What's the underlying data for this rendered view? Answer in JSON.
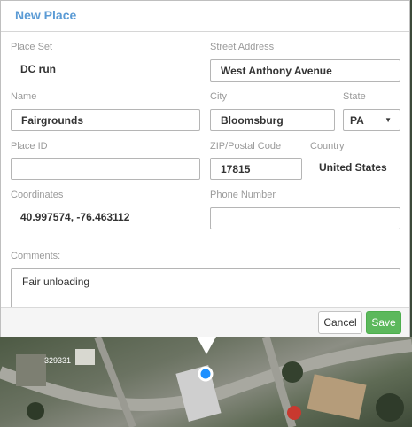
{
  "dialog": {
    "title": "New Place",
    "place_set": {
      "label": "Place Set",
      "value": "DC run"
    },
    "name": {
      "label": "Name",
      "value": "Fairgrounds"
    },
    "place_id": {
      "label": "Place ID",
      "value": ""
    },
    "coordinates": {
      "label": "Coordinates",
      "value": "40.997574, -76.463112"
    },
    "street": {
      "label": "Street Address",
      "value": "West Anthony Avenue"
    },
    "city": {
      "label": "City",
      "value": "Bloomsburg"
    },
    "state": {
      "label": "State",
      "value": "PA"
    },
    "zip": {
      "label": "ZIP/Postal Code",
      "value": "17815"
    },
    "country": {
      "label": "Country",
      "value": "United States"
    },
    "phone": {
      "label": "Phone Number",
      "value": ""
    },
    "comments": {
      "label": "Comments:",
      "value": "Fair unloading"
    }
  },
  "buttons": {
    "cancel": "Cancel",
    "save": "Save"
  },
  "map": {
    "parcel_label": "329331"
  },
  "colors": {
    "title": "#5b9bd5",
    "save": "#5cb85c",
    "marker": "#1e90ff"
  },
  "icons": {
    "state_dropdown": "chevron-down-icon",
    "marker": "location-pin-icon"
  }
}
